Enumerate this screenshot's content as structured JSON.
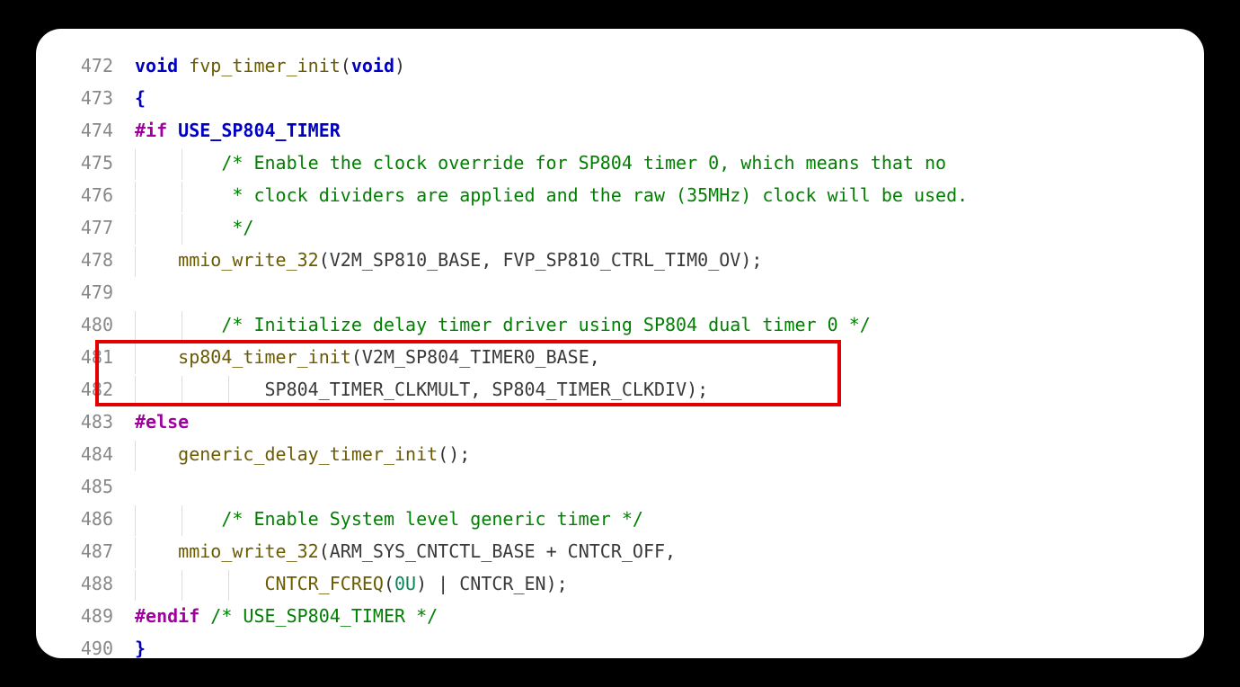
{
  "code": {
    "lines": [
      {
        "num": "472",
        "indent": 0,
        "tokens": [
          {
            "t": "void ",
            "c": "type"
          },
          {
            "t": "fvp_timer_init",
            "c": "fn"
          },
          {
            "t": "(",
            "c": "punct"
          },
          {
            "t": "void",
            "c": "type"
          },
          {
            "t": ")",
            "c": "punct"
          }
        ]
      },
      {
        "num": "473",
        "indent": 0,
        "tokens": [
          {
            "t": "{",
            "c": "brace"
          }
        ]
      },
      {
        "num": "474",
        "indent": 0,
        "tokens": [
          {
            "t": "#if ",
            "c": "pp"
          },
          {
            "t": "USE_SP804_TIMER",
            "c": "macro"
          }
        ]
      },
      {
        "num": "475",
        "indent": 2,
        "tokens": [
          {
            "t": "/* Enable the clock override for SP804 timer 0, which means that no",
            "c": "comment"
          }
        ]
      },
      {
        "num": "476",
        "indent": 2,
        "tokens": [
          {
            "t": " * clock dividers are applied and the raw (35MHz) clock will be used.",
            "c": "comment"
          }
        ]
      },
      {
        "num": "477",
        "indent": 2,
        "tokens": [
          {
            "t": " */",
            "c": "comment"
          }
        ]
      },
      {
        "num": "478",
        "indent": 1,
        "tokens": [
          {
            "t": "mmio_write_32",
            "c": "fn"
          },
          {
            "t": "(",
            "c": "punct"
          },
          {
            "t": "V2M_SP810_BASE",
            "c": "ident"
          },
          {
            "t": ", ",
            "c": "punct"
          },
          {
            "t": "FVP_SP810_CTRL_TIM0_OV",
            "c": "ident"
          },
          {
            "t": ");",
            "c": "punct"
          }
        ]
      },
      {
        "num": "479",
        "indent": 0,
        "tokens": [
          {
            "t": "",
            "c": "ident"
          }
        ]
      },
      {
        "num": "480",
        "indent": 2,
        "tokens": [
          {
            "t": "/* Initialize delay timer driver using SP804 dual timer 0 */",
            "c": "comment"
          }
        ]
      },
      {
        "num": "481",
        "indent": 1,
        "tokens": [
          {
            "t": "sp804_timer_init",
            "c": "fn"
          },
          {
            "t": "(",
            "c": "punct"
          },
          {
            "t": "V2M_SP804_TIMER0_BASE",
            "c": "ident"
          },
          {
            "t": ",",
            "c": "punct"
          }
        ]
      },
      {
        "num": "482",
        "indent": 3,
        "tokens": [
          {
            "t": "SP804_TIMER_CLKMULT",
            "c": "ident"
          },
          {
            "t": ", ",
            "c": "punct"
          },
          {
            "t": "SP804_TIMER_CLKDIV",
            "c": "ident"
          },
          {
            "t": ");",
            "c": "punct"
          }
        ]
      },
      {
        "num": "483",
        "indent": 0,
        "tokens": [
          {
            "t": "#else",
            "c": "pp"
          }
        ]
      },
      {
        "num": "484",
        "indent": 1,
        "tokens": [
          {
            "t": "generic_delay_timer_init",
            "c": "fn"
          },
          {
            "t": "();",
            "c": "punct"
          }
        ]
      },
      {
        "num": "485",
        "indent": 0,
        "tokens": [
          {
            "t": "",
            "c": "ident"
          }
        ]
      },
      {
        "num": "486",
        "indent": 2,
        "tokens": [
          {
            "t": "/* Enable System level generic timer */",
            "c": "comment"
          }
        ]
      },
      {
        "num": "487",
        "indent": 1,
        "tokens": [
          {
            "t": "mmio_write_32",
            "c": "fn"
          },
          {
            "t": "(",
            "c": "punct"
          },
          {
            "t": "ARM_SYS_CNTCTL_BASE",
            "c": "ident"
          },
          {
            "t": " + ",
            "c": "punct"
          },
          {
            "t": "CNTCR_OFF",
            "c": "ident"
          },
          {
            "t": ",",
            "c": "punct"
          }
        ]
      },
      {
        "num": "488",
        "indent": 3,
        "tokens": [
          {
            "t": "CNTCR_FCREQ",
            "c": "fn"
          },
          {
            "t": "(",
            "c": "punct"
          },
          {
            "t": "0U",
            "c": "num"
          },
          {
            "t": ") | ",
            "c": "punct"
          },
          {
            "t": "CNTCR_EN",
            "c": "ident"
          },
          {
            "t": ");",
            "c": "punct"
          }
        ]
      },
      {
        "num": "489",
        "indent": 0,
        "tokens": [
          {
            "t": "#endif ",
            "c": "pp"
          },
          {
            "t": "/* USE_SP804_TIMER */",
            "c": "comment"
          }
        ]
      },
      {
        "num": "490",
        "indent": 0,
        "tokens": [
          {
            "t": "}",
            "c": "brace"
          }
        ]
      }
    ]
  },
  "highlight": {
    "startLine": 481,
    "endLine": 482
  },
  "colors": {
    "highlightBorder": "#e20000",
    "bg": "#000",
    "panel": "#fff"
  }
}
